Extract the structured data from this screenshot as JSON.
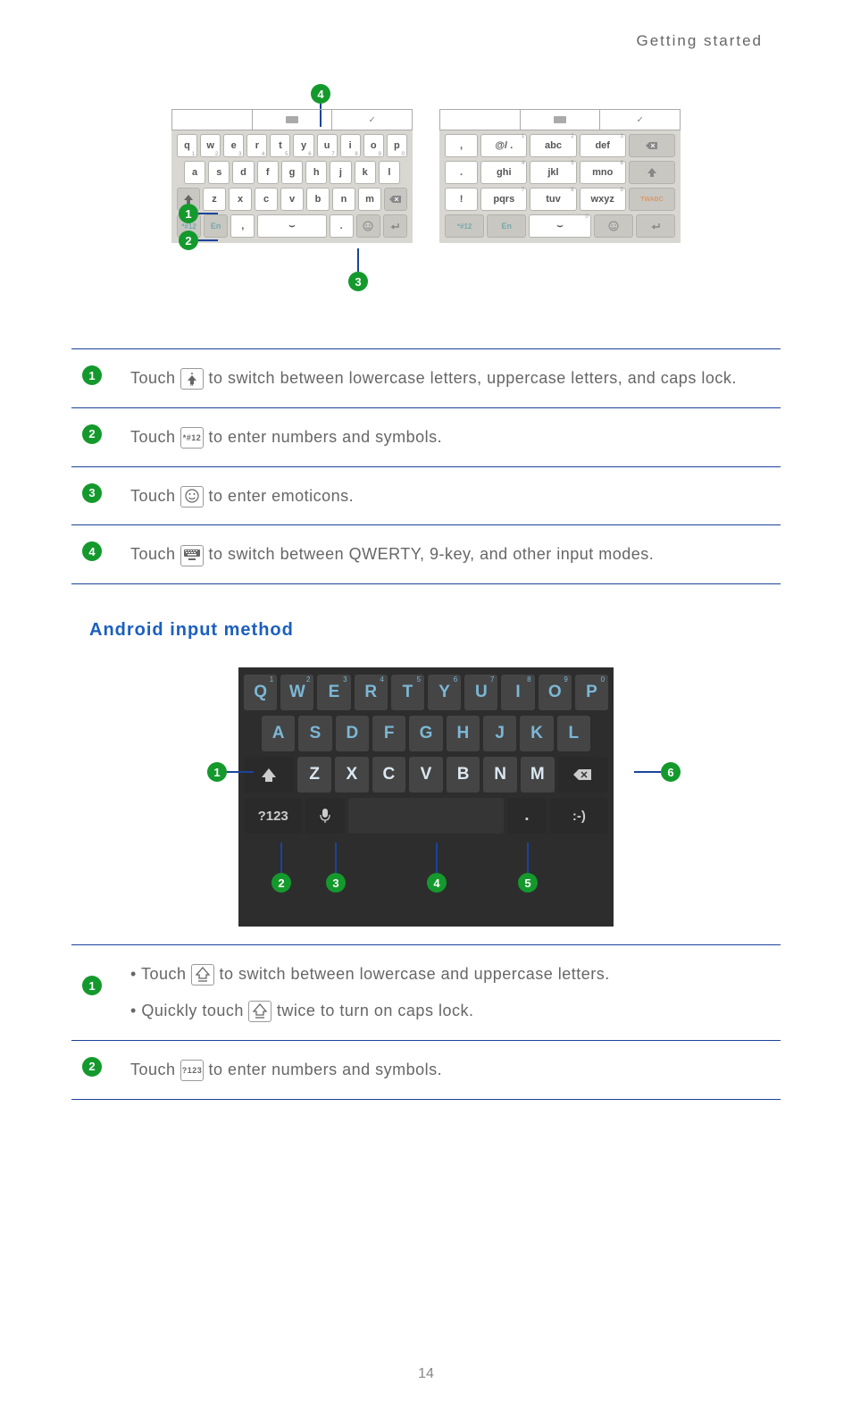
{
  "header": "Getting started",
  "page_number": "14",
  "huawei_qwerty": {
    "row1": [
      "q",
      "w",
      "e",
      "r",
      "t",
      "y",
      "u",
      "i",
      "o",
      "p"
    ],
    "row1_sub": [
      "1",
      "2",
      "3",
      "4",
      "5",
      "6",
      "7",
      "8",
      "9",
      "0"
    ],
    "row2": [
      "a",
      "s",
      "d",
      "f",
      "g",
      "h",
      "j",
      "k",
      "l"
    ],
    "row3": [
      "z",
      "x",
      "c",
      "v",
      "b",
      "n",
      "m"
    ],
    "sym_key": "*#12",
    "lang_key": "En"
  },
  "huawei_9key": {
    "row1": [
      {
        "m": ",",
        "s": ""
      },
      {
        "m": "@/ .",
        "s": "1"
      },
      {
        "m": "abc",
        "s": "2"
      },
      {
        "m": "def",
        "s": "3"
      }
    ],
    "row2": [
      {
        "m": ".",
        "s": ""
      },
      {
        "m": "ghi",
        "s": "4"
      },
      {
        "m": "jkl",
        "s": "5"
      },
      {
        "m": "mno",
        "s": "6"
      }
    ],
    "row3": [
      {
        "m": "!",
        "s": ""
      },
      {
        "m": "pqrs",
        "s": "7"
      },
      {
        "m": "tuv",
        "s": "8"
      },
      {
        "m": "wxyz",
        "s": "9"
      }
    ],
    "sym_key": "*#12",
    "lang_key": "En",
    "zero_key": "0"
  },
  "desc1": {
    "i1": "Touch      to switch between lowercase letters, uppercase letters, and caps lock.",
    "i1_icon_text": "",
    "i2": "Touch      to enter numbers and symbols.",
    "i2_icon_text": "*#12",
    "i3": "Touch      to enter emoticons.",
    "i4": "Touch      to switch between QWERTY, 9-key, and other input modes."
  },
  "sec2_heading": "Android input method",
  "android_kb": {
    "row1": [
      "Q",
      "W",
      "E",
      "R",
      "T",
      "Y",
      "U",
      "I",
      "O",
      "P"
    ],
    "row1_sup": [
      "1",
      "2",
      "3",
      "4",
      "5",
      "6",
      "7",
      "8",
      "9",
      "0"
    ],
    "row2": [
      "A",
      "S",
      "D",
      "F",
      "G",
      "H",
      "J",
      "K",
      "L"
    ],
    "row3": [
      "Z",
      "X",
      "C",
      "V",
      "B",
      "N",
      "M"
    ],
    "sym": "?123",
    "emo": ":-)"
  },
  "desc2": {
    "i1a": "Touch      to switch between lowercase and uppercase letters.",
    "i1b": "Quickly touch      twice to turn on caps lock.",
    "i2": "Touch      to enter numbers and symbols.",
    "i2_icon_text": "?123"
  }
}
